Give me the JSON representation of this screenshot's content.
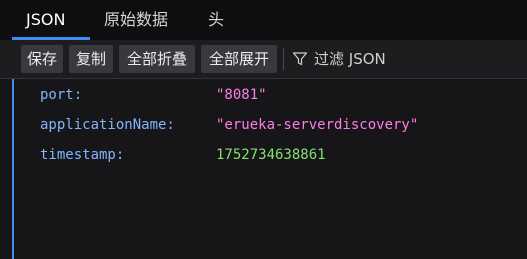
{
  "tabs": [
    {
      "label": "JSON",
      "active": true
    },
    {
      "label": "原始数据",
      "active": false
    },
    {
      "label": "头",
      "active": false
    }
  ],
  "toolbar": {
    "save_label": "保存",
    "copy_label": "复制",
    "collapse_all_label": "全部折叠",
    "expand_all_label": "全部展开",
    "filter_placeholder": "过滤 JSON",
    "filter_icon": "funnel-icon"
  },
  "rows": [
    {
      "key": "port:",
      "value": "\"8081\"",
      "type": "string"
    },
    {
      "key": "applicationName:",
      "value": "\"erueka-serverdiscovery\"",
      "type": "string"
    },
    {
      "key": "timestamp:",
      "value": "1752734638861",
      "type": "number"
    }
  ],
  "colors": {
    "accent": "#3f8ef5",
    "key": "#82b4ff",
    "string": "#ff7de9",
    "number": "#86de74"
  }
}
